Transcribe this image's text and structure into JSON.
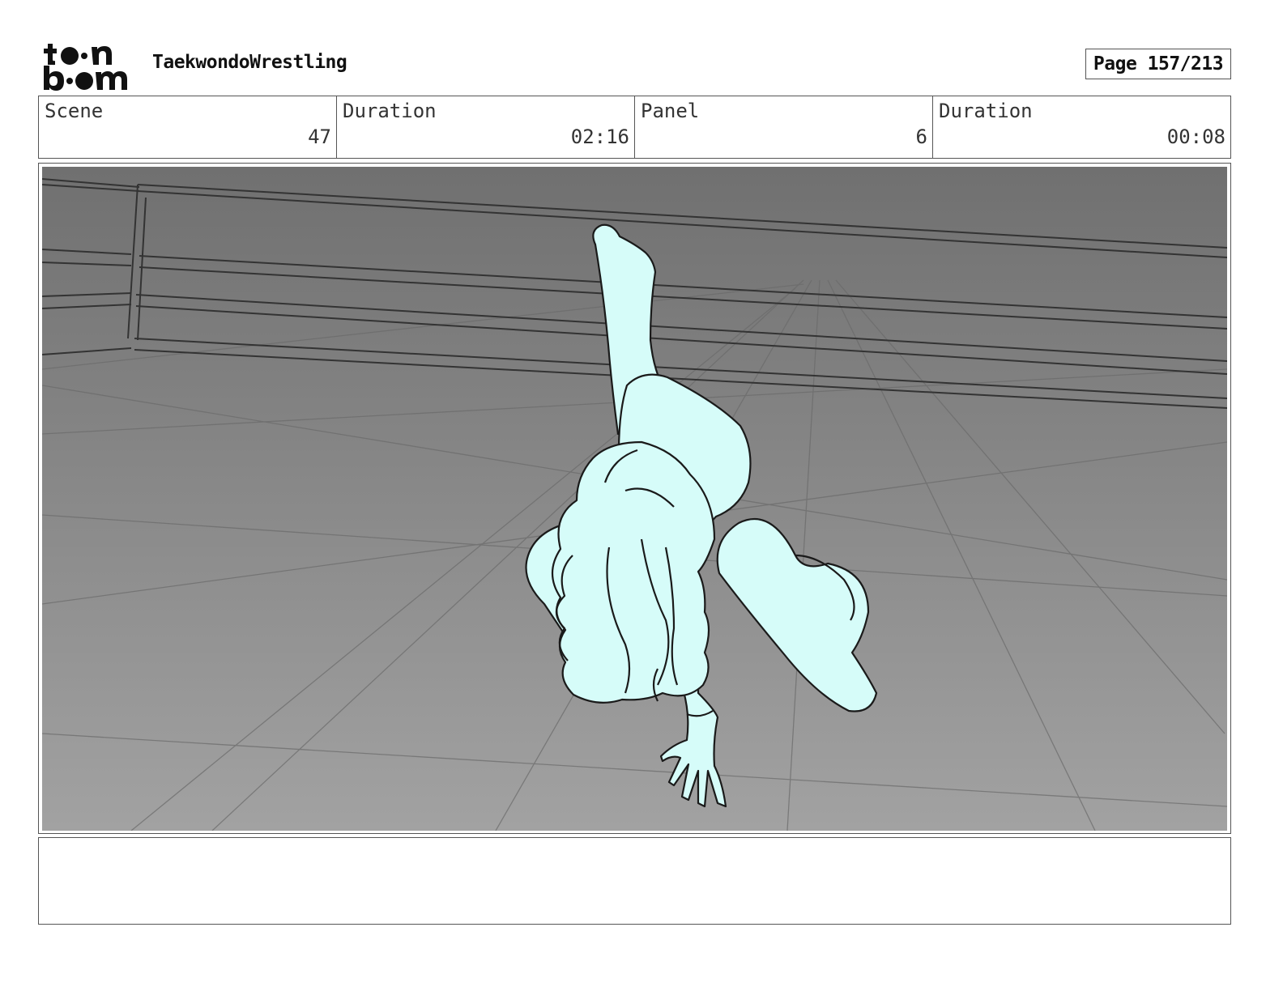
{
  "header": {
    "logo_name": "toon-boom-logo",
    "project_title": "TaekwondoWrestling",
    "page_label": "Page 157/213"
  },
  "info": {
    "scene": {
      "label": "Scene",
      "value": "47"
    },
    "scene_duration": {
      "label": "Duration",
      "value": "02:16"
    },
    "panel": {
      "label": "Panel",
      "value": "6"
    },
    "panel_duration": {
      "label": "Duration",
      "value": "00:08"
    }
  },
  "panel_art": {
    "background_top": "#707070",
    "background_bottom": "#a2a2a2",
    "figure_fill": "#d6fcf9",
    "line_color": "#1a1a1a"
  },
  "notes": {
    "text": ""
  }
}
